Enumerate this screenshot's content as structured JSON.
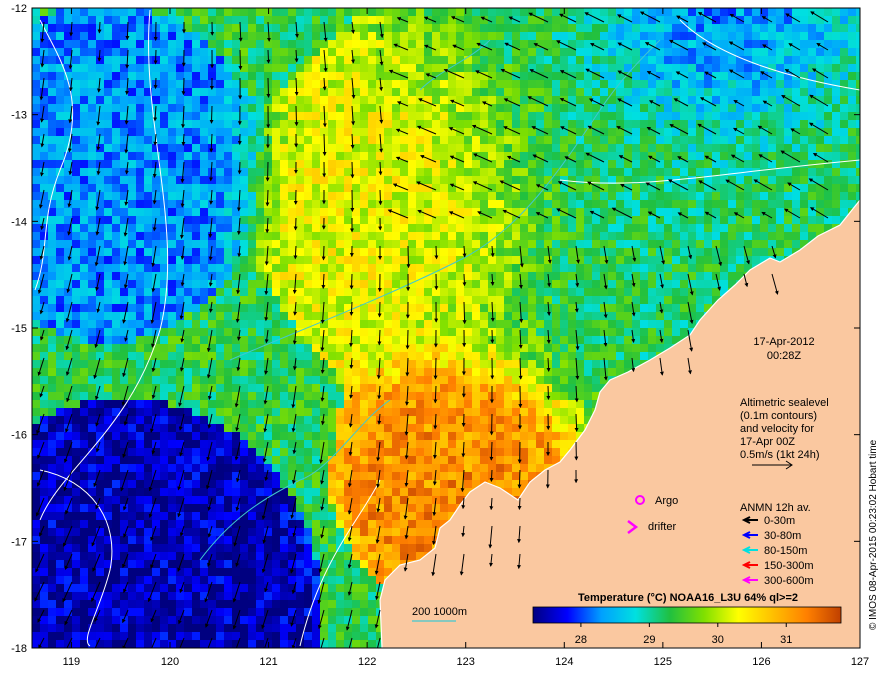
{
  "map": {
    "date": "17-Apr-2012",
    "time": "00:28Z",
    "altimetry_lines": [
      "Altimetric sealevel",
      "(0.1m contours)",
      "and velocity for",
      "17-Apr 00Z",
      "0.5m/s (1kt 24h)"
    ],
    "legend_title": "ANMN 12h av.",
    "legend_items": [
      {
        "label": "0-30m",
        "color": "#000000"
      },
      {
        "label": "30-80m",
        "color": "#0000ff"
      },
      {
        "label": "80-150m",
        "color": "#00e0e0"
      },
      {
        "label": "150-300m",
        "color": "#ff0000"
      },
      {
        "label": "300-600m",
        "color": "#ff00ff"
      }
    ],
    "argo_label": "Argo",
    "drifter_label": "drifter",
    "argo_color": "#ff00ff",
    "isobath_label": "200  1000m",
    "isobath_color": "#40c8d0",
    "credit": "© IMOS 08-Apr-2015 00:23:02 Hobart time",
    "colorbar": {
      "title": "Temperature (°C) NOAA16_L3U 64% ql>=2",
      "ticks": [
        "28",
        "29",
        "30",
        "31"
      ],
      "range": [
        27.3,
        31.8
      ],
      "stops": [
        "#000080",
        "#0000ff",
        "#00a0ff",
        "#00e0e0",
        "#20c040",
        "#80e000",
        "#ffff00",
        "#ffc000",
        "#ff8000",
        "#c04000"
      ]
    },
    "lon_ticks": [
      "119",
      "120",
      "121",
      "122",
      "123",
      "124",
      "125",
      "126",
      "127"
    ],
    "lat_ticks": [
      "-12",
      "-13",
      "-14",
      "-15",
      "-16",
      "-17",
      "-18"
    ],
    "lon_range": [
      118.6,
      127.0
    ],
    "lat_range": [
      -12.0,
      -18.0
    ],
    "land_color": "#fac8a0",
    "sst_zones": [
      {
        "lon": 123.0,
        "lat": -16.3,
        "temp": 31.2,
        "spread": 0.7
      },
      {
        "lon": 122.6,
        "lat": -13.8,
        "temp": 30.3,
        "spread": 0.9
      },
      {
        "lon": 119.5,
        "lat": -17.6,
        "temp": 27.5,
        "spread": 1.0
      },
      {
        "lon": 119.3,
        "lat": -13.5,
        "temp": 28.3,
        "spread": 0.8
      },
      {
        "lon": 125.4,
        "lat": -12.2,
        "temp": 28.0,
        "spread": 0.8
      },
      {
        "lon": 124.8,
        "lat": -13.5,
        "temp": 29.2,
        "spread": 1.5
      }
    ]
  }
}
